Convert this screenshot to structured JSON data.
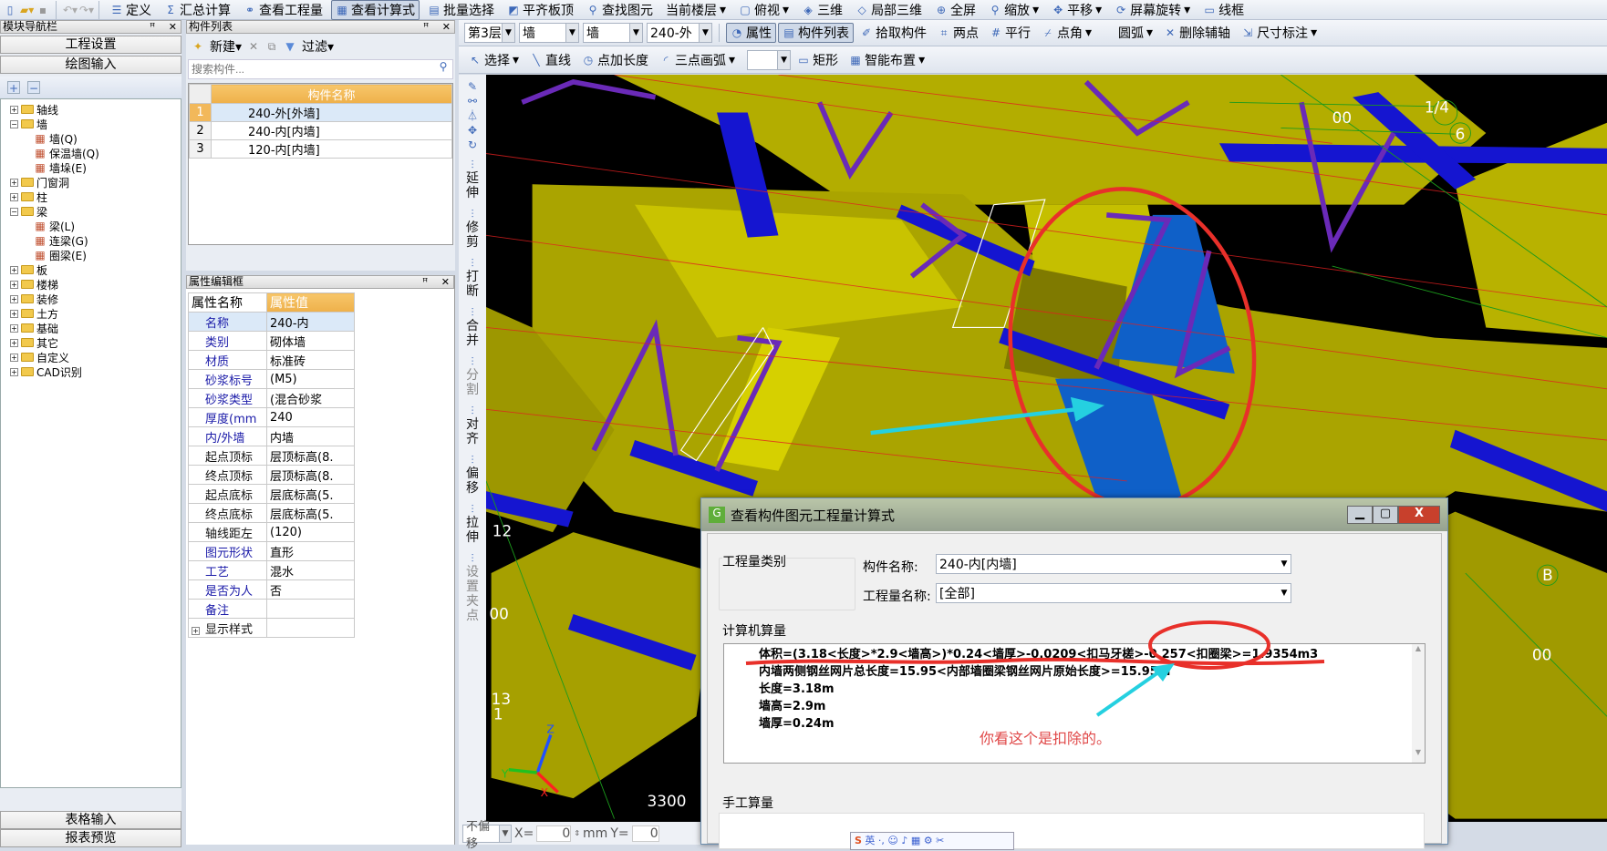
{
  "main_toolbar": {
    "items": [
      "定义",
      "汇总计算",
      "查看工程量",
      "查看计算式",
      "批量选择",
      "平齐板顶",
      "查找图元",
      "当前楼层",
      "俯视",
      "三维",
      "局部三维",
      "全屏",
      "缩放",
      "平移",
      "屏幕旋转",
      "线框"
    ]
  },
  "nav_panel": {
    "title": "模块导航栏",
    "buttons": [
      "工程设置",
      "绘图输入"
    ],
    "tree": [
      {
        "label": "轴线",
        "level": 0,
        "expanded": false
      },
      {
        "label": "墙",
        "level": 0,
        "expanded": true
      },
      {
        "label": "墙(Q)",
        "level": 1
      },
      {
        "label": "保温墙(Q)",
        "level": 1
      },
      {
        "label": "墙垛(E)",
        "level": 1
      },
      {
        "label": "门窗洞",
        "level": 0,
        "expanded": false
      },
      {
        "label": "柱",
        "level": 0,
        "expanded": false
      },
      {
        "label": "梁",
        "level": 0,
        "expanded": true
      },
      {
        "label": "梁(L)",
        "level": 1
      },
      {
        "label": "连梁(G)",
        "level": 1
      },
      {
        "label": "圈梁(E)",
        "level": 1
      },
      {
        "label": "板",
        "level": 0,
        "expanded": false
      },
      {
        "label": "楼梯",
        "level": 0,
        "expanded": false
      },
      {
        "label": "装修",
        "level": 0,
        "expanded": false
      },
      {
        "label": "土方",
        "level": 0,
        "expanded": false
      },
      {
        "label": "基础",
        "level": 0,
        "expanded": false
      },
      {
        "label": "其它",
        "level": 0,
        "expanded": false
      },
      {
        "label": "自定义",
        "level": 0,
        "expanded": false
      },
      {
        "label": "CAD识别",
        "level": 0,
        "expanded": false
      }
    ],
    "bottom_buttons": [
      "表格输入",
      "报表预览"
    ]
  },
  "component_list": {
    "title": "构件列表",
    "new_label": "新建",
    "filter_label": "过滤",
    "search_placeholder": "搜索构件...",
    "column": "构件名称",
    "rows": [
      {
        "no": "1",
        "name": "240-外[外墙]",
        "selected": true
      },
      {
        "no": "2",
        "name": "240-内[内墙]"
      },
      {
        "no": "3",
        "name": "120-内[内墙]"
      }
    ]
  },
  "property_panel": {
    "title": "属性编辑框",
    "col_name": "属性名称",
    "col_value": "属性值",
    "rows": [
      {
        "name": "名称",
        "value": "240-内",
        "blue": true
      },
      {
        "name": "类别",
        "value": "砌体墙",
        "blue": true
      },
      {
        "name": "材质",
        "value": "标准砖",
        "blue": true
      },
      {
        "name": "砂浆标号",
        "value": "(M5)",
        "blue": true
      },
      {
        "name": "砂浆类型",
        "value": "(混合砂浆",
        "blue": true
      },
      {
        "name": "厚度(mm",
        "value": "240",
        "blue": true
      },
      {
        "name": "内/外墙",
        "value": "内墙",
        "blue": true
      },
      {
        "name": "起点顶标",
        "value": "层顶标高(8.",
        "blue": false
      },
      {
        "name": "终点顶标",
        "value": "层顶标高(8.",
        "blue": false
      },
      {
        "name": "起点底标",
        "value": "层底标高(5.",
        "blue": false
      },
      {
        "name": "终点底标",
        "value": "层底标高(5.",
        "blue": false
      },
      {
        "name": "轴线距左",
        "value": "(120)",
        "blue": false
      },
      {
        "name": "图元形状",
        "value": "直形",
        "blue": true
      },
      {
        "name": "工艺",
        "value": "混水",
        "blue": true
      },
      {
        "name": "是否为人",
        "value": "否",
        "blue": true
      },
      {
        "name": "备注",
        "value": "",
        "blue": true
      },
      {
        "name": "显示样式",
        "value": "",
        "blue": false,
        "expander": true
      }
    ]
  },
  "draw_toolbar": {
    "floor": "第3层",
    "type1": "墙",
    "type2": "墙",
    "component": "240-外",
    "row1": [
      "属性",
      "构件列表",
      "拾取构件",
      "两点",
      "平行",
      "点角",
      "圆弧",
      "删除辅轴",
      "尺寸标注"
    ],
    "row2": [
      "选择",
      "直线",
      "点加长度",
      "三点画弧",
      "矩形",
      "智能布置"
    ]
  },
  "vertical_toolbar": [
    "延伸",
    "修剪",
    "打断",
    "合并",
    "分割",
    "对齐",
    "偏移",
    "拉伸",
    "设置夹点"
  ],
  "viewport": {
    "labels": [
      "1/4",
      "6",
      "00",
      "12",
      "00",
      "13",
      "1",
      "3300",
      "B",
      "00"
    ],
    "axis": [
      "Z",
      "Y",
      "X"
    ],
    "colors": {
      "background": "#000000",
      "wall": "#b5b000",
      "beam": "#1515d0",
      "ring_beam": "#6a2ab8",
      "annotation": "#e8302a",
      "arrow": "#25d0e0"
    }
  },
  "status_bar": {
    "offset_mode": "不偏移",
    "x_label": "X=",
    "x_value": "0",
    "unit": "mm",
    "y_label": "Y=",
    "y_value": "0"
  },
  "dialog": {
    "title": "查看构件图元工程量计算式",
    "category_label": "工程量类别",
    "component_label": "构件名称:",
    "component_value": "240-内[内墙]",
    "quantity_label": "工程量名称:",
    "quantity_value": "[全部]",
    "computer_label": "计算机算量",
    "formulas": [
      "体积=(3.18<长度>*2.9<墙高>)*0.24<墙厚>-0.0209<扣马牙槎>-0.257<扣圈梁>=1.9354m3",
      "内墙两侧钢丝网片总长度=15.95<内部墙圈梁钢丝网片原始长度>=15.95m",
      "长度=3.18m",
      "墙高=2.9m",
      "墙厚=0.24m"
    ],
    "annotation": "你看这个是扣除的。",
    "manual_label": "手工算量"
  }
}
